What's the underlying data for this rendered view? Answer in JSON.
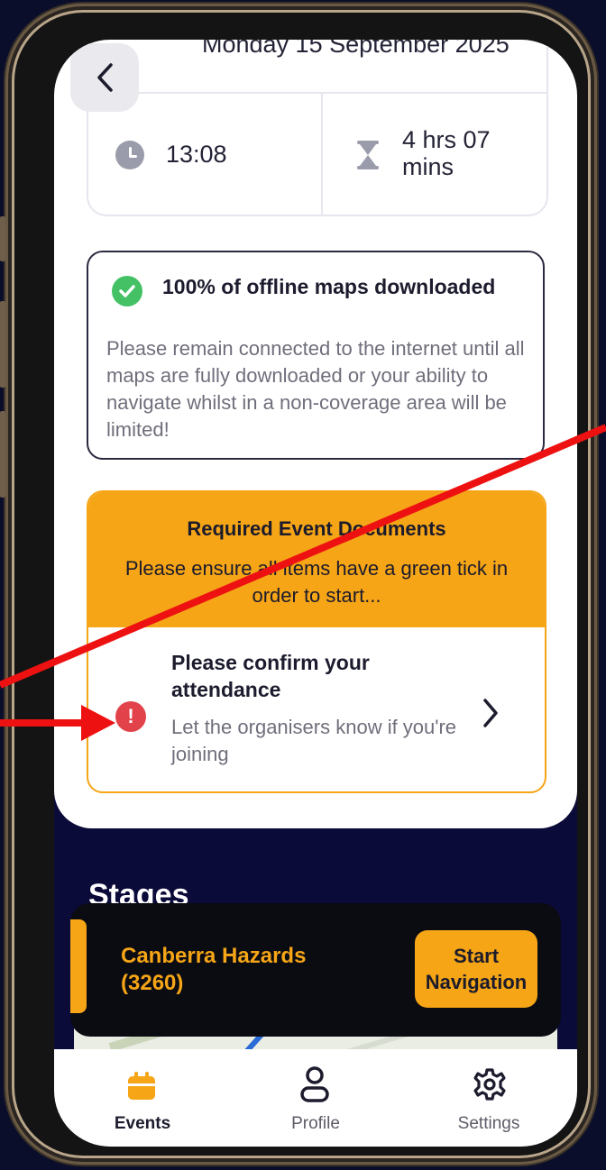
{
  "header": {
    "date": "Monday 15 September 2025",
    "time": "13:08",
    "duration_line1": "4 hrs 07",
    "duration_line2": "mins"
  },
  "maps_notice": {
    "title": "100% of offline maps downloaded",
    "body": "Please remain connected to the internet until all maps are fully downloaded or your ability to navigate whilst in a non-coverage area will be limited!"
  },
  "required_docs": {
    "title": "Required Event Documents",
    "subtitle": "Please ensure all items have a green tick in order to start...",
    "item_title": "Please confirm your attendance",
    "item_subtitle": "Let the organisers know if you're joining"
  },
  "stages_heading": "Stages",
  "navigation": {
    "route_name": "Canberra Hazards (3260)",
    "start_label": "Start Navigation"
  },
  "tabs": [
    {
      "label": "Events"
    },
    {
      "label": "Profile"
    },
    {
      "label": "Settings"
    }
  ],
  "colors": {
    "accent": "#f5a516",
    "success": "#43c164",
    "alert": "#e2434b",
    "annotation": "#ee1111"
  },
  "icons": [
    "chevron-left-icon",
    "clock-icon",
    "hourglass-icon",
    "check-circle-icon",
    "alert-circle-icon",
    "chevron-right-icon",
    "calendar-icon",
    "user-icon",
    "gear-icon"
  ]
}
